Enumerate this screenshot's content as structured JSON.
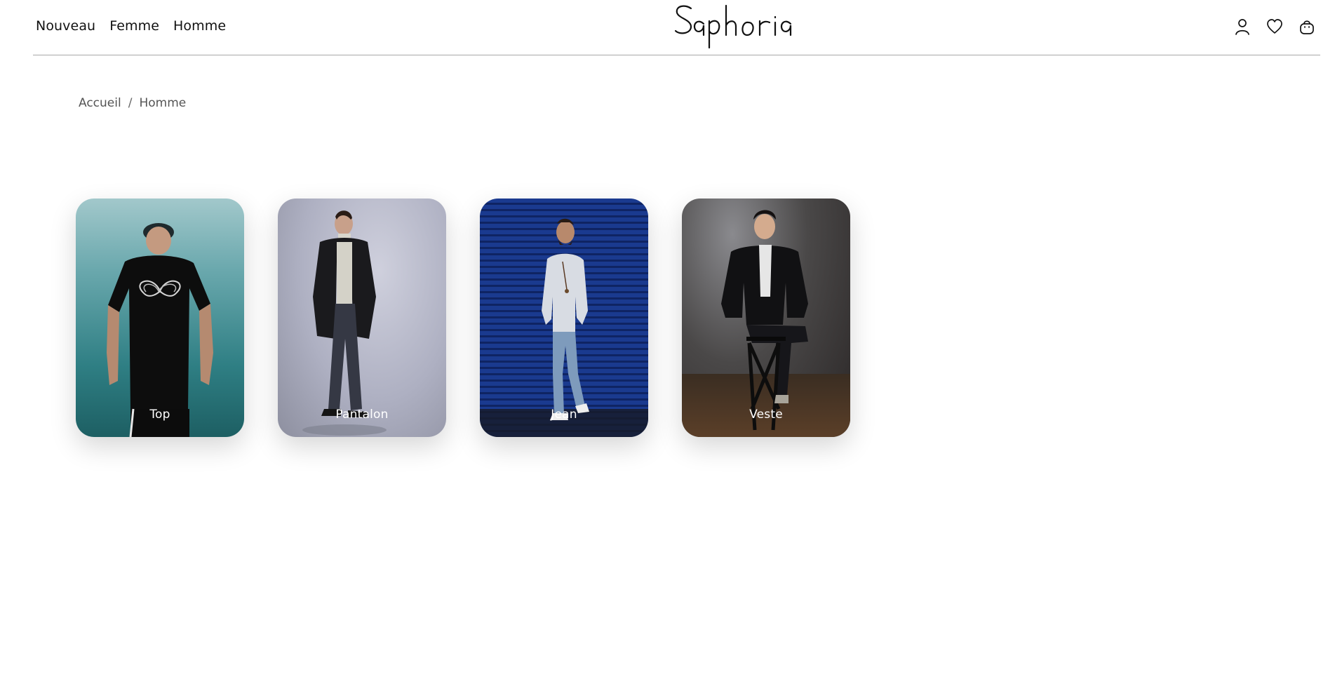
{
  "nav": {
    "items": [
      "Nouveau",
      "Femme",
      "Homme"
    ]
  },
  "logo": {
    "text": "Saphoria"
  },
  "header_icons": [
    "user-icon",
    "heart-icon",
    "bag-icon"
  ],
  "breadcrumb": {
    "home": "Accueil",
    "separator": "/",
    "current": "Homme"
  },
  "categories": [
    {
      "label": "Top"
    },
    {
      "label": "Pantalon"
    },
    {
      "label": "Jean"
    },
    {
      "label": "Veste"
    }
  ]
}
